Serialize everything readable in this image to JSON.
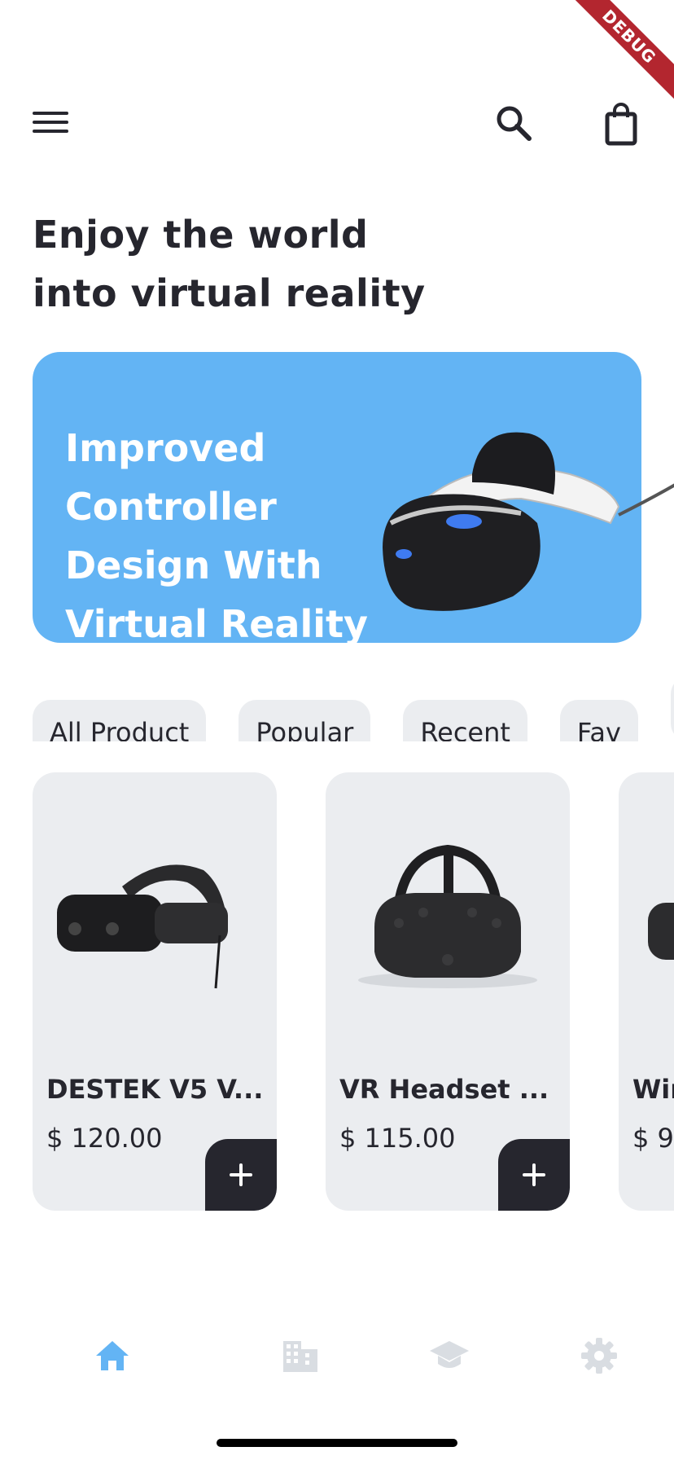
{
  "debug_label": "DEBUG",
  "headline": {
    "line1": "Enjoy the world",
    "line2": "into virtual reality"
  },
  "banner": {
    "line1": "Improved Controller",
    "line2": "Design With",
    "line3": "Virtual Reality",
    "image": "vr-headset-playstation"
  },
  "categories": [
    "All Product",
    "Popular",
    "Recent",
    "Fav"
  ],
  "products": [
    {
      "name": "DESTEK V5 V...",
      "price": "$ 120.00",
      "image": "vr-headset-destek"
    },
    {
      "name": "VR Headset ...",
      "price": "$ 115.00",
      "image": "vr-headset-htc"
    },
    {
      "name": "Wir",
      "price": "$ 9",
      "image": "vr-headset"
    }
  ],
  "icons": {
    "menu": "menu-icon",
    "search": "search-icon",
    "cart": "shopping-bag-icon",
    "nav": [
      "home-icon",
      "business-icon",
      "school-icon",
      "settings-icon"
    ]
  },
  "colors": {
    "accent": "#63b4f4",
    "card_bg": "#ebedf0",
    "dark": "#26262e",
    "nav_inactive": "#d9dde2"
  }
}
